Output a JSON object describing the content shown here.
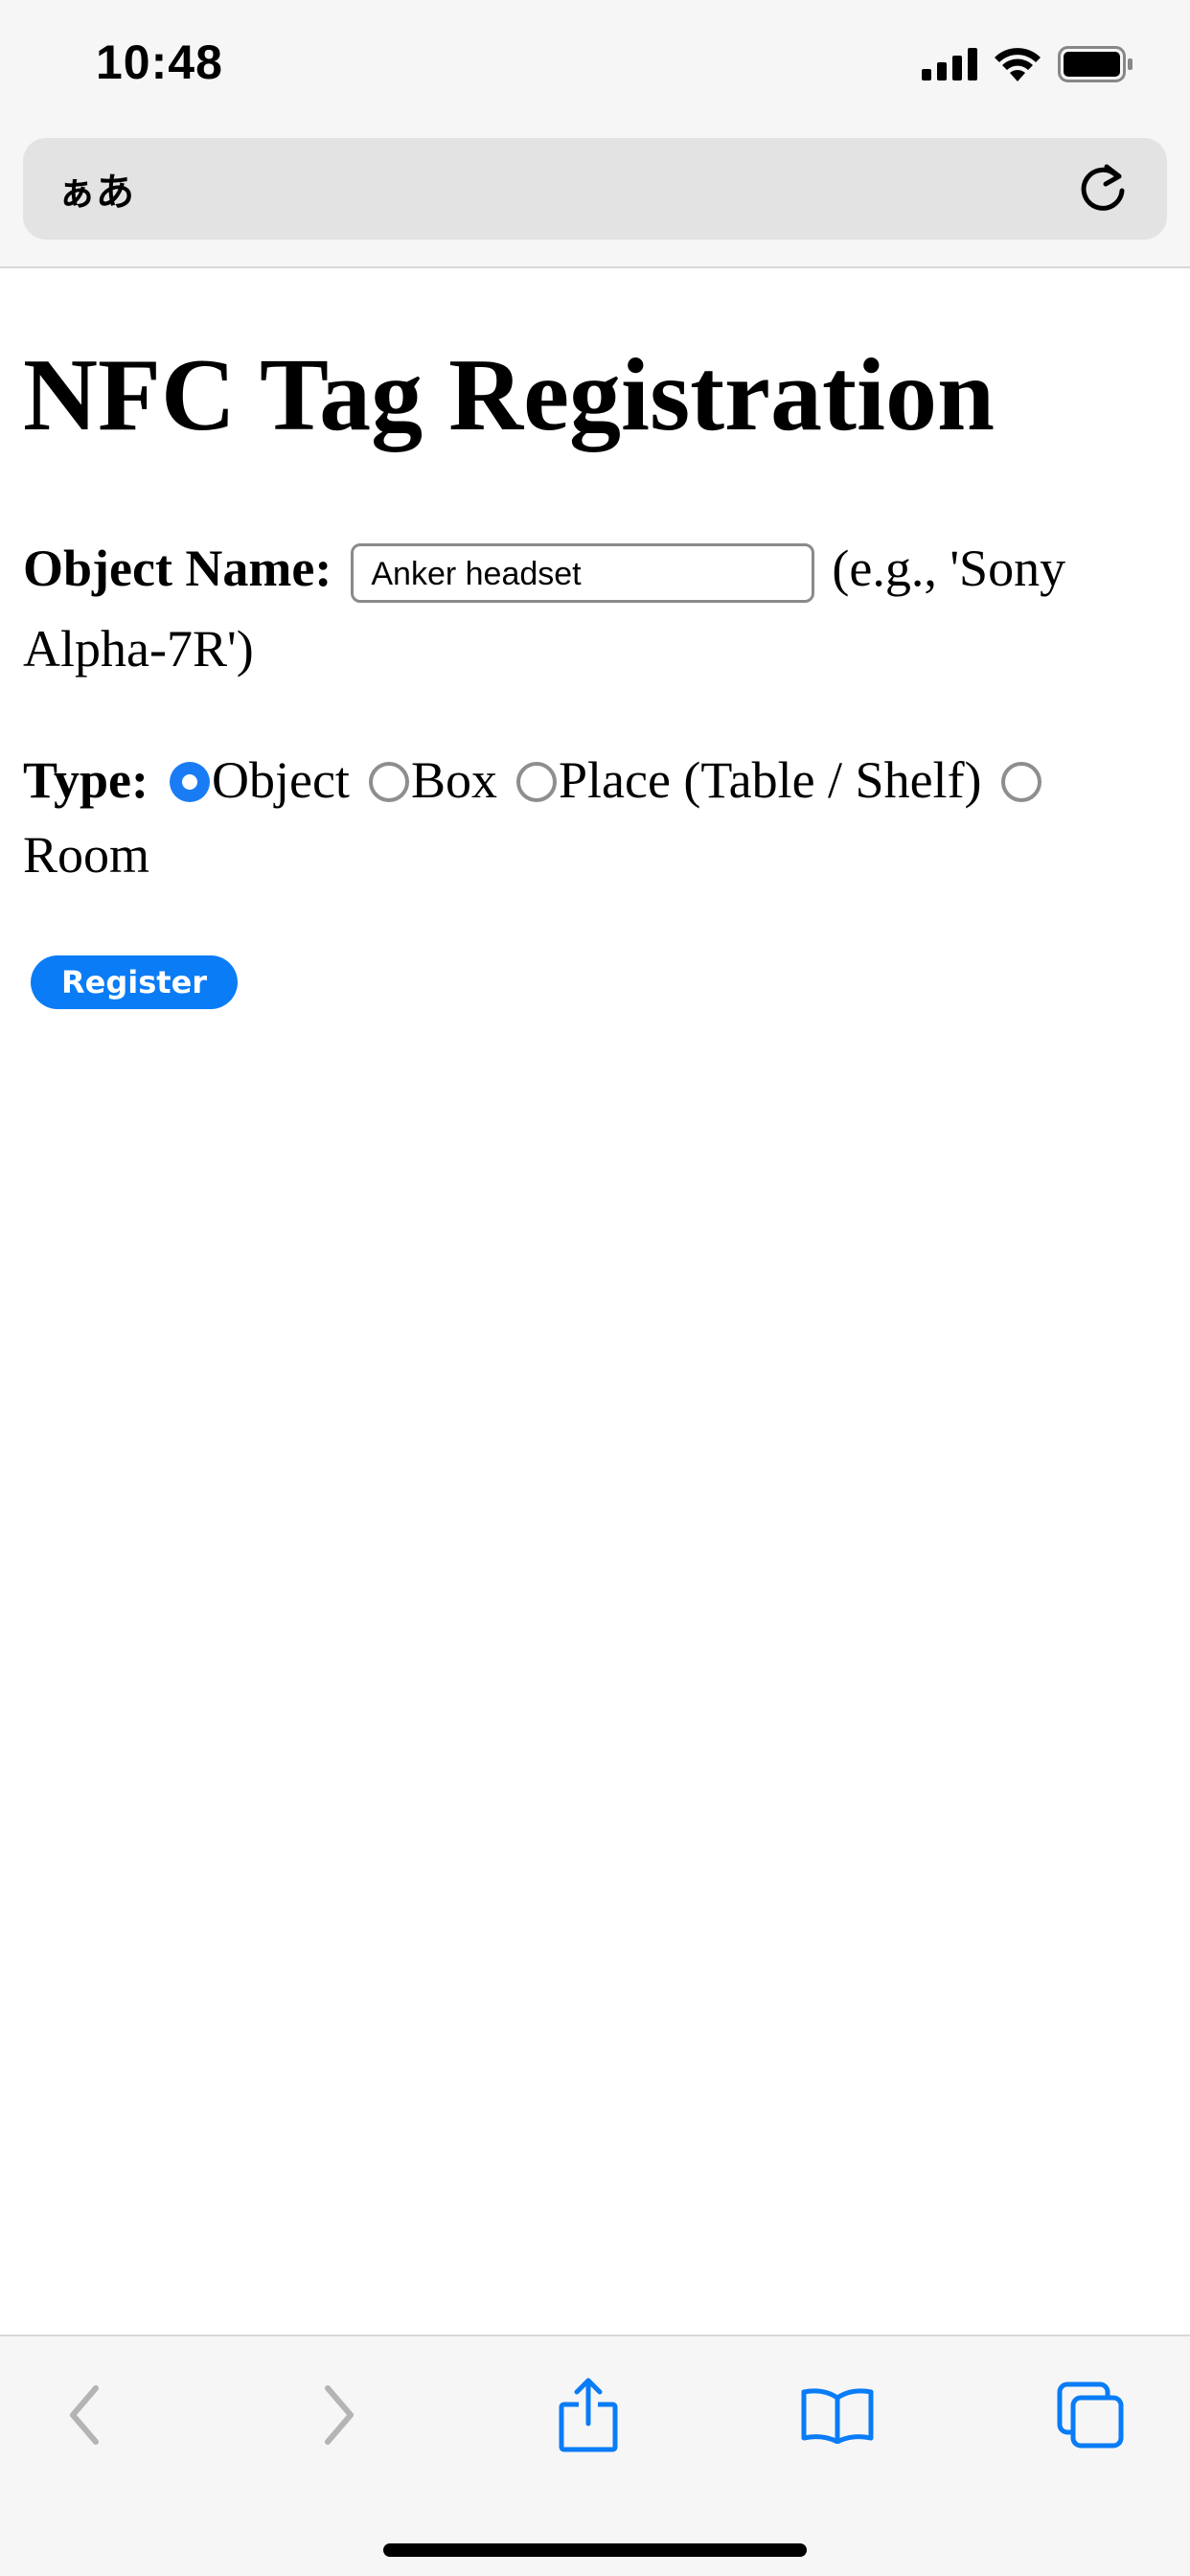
{
  "status_bar": {
    "time": "10:48",
    "icons": [
      "cellular-signal-icon",
      "wifi-icon",
      "battery-icon"
    ]
  },
  "browser": {
    "aa_label": "ぁあ",
    "reload_icon": "reload-icon"
  },
  "page": {
    "title": "NFC Tag Registration",
    "object_name_label": "Object Name:",
    "object_name_value": "Anker headset",
    "object_name_hint": "(e.g., 'Sony Alpha-7R')",
    "type_label": "Type:",
    "type_options": [
      {
        "label": "Object",
        "checked": true
      },
      {
        "label": "Box",
        "checked": false
      },
      {
        "label": "Place (Table / Shelf)",
        "checked": false
      },
      {
        "label": "Room",
        "checked": false
      }
    ],
    "register_label": "Register"
  },
  "toolbar": {
    "icons": [
      "back-icon",
      "forward-icon",
      "share-icon",
      "bookmarks-icon",
      "tabs-icon"
    ]
  },
  "colors": {
    "accent": "#0a7cf6",
    "disabled": "#b4b4b4"
  }
}
